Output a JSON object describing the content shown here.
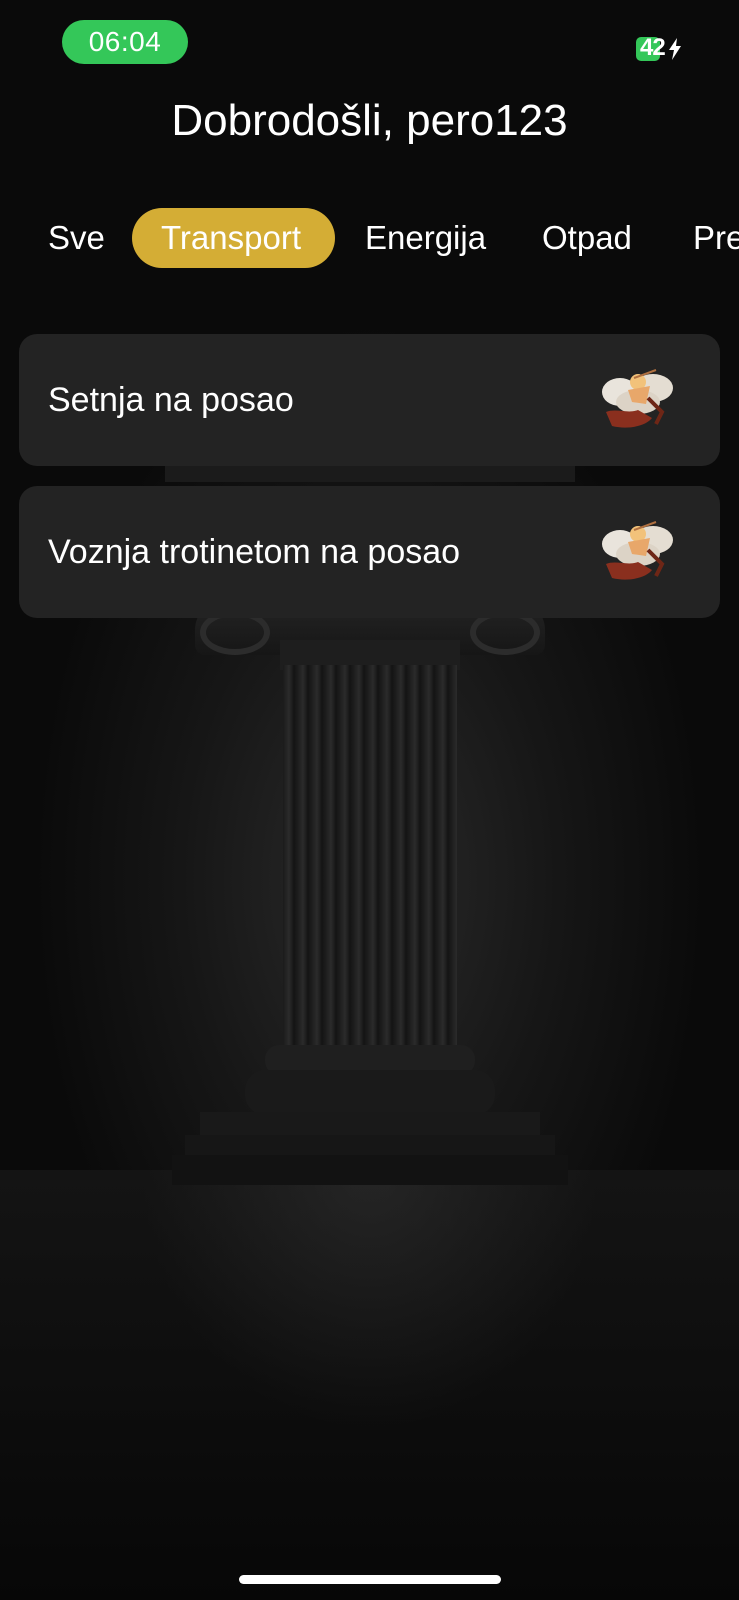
{
  "status_bar": {
    "time": "06:04",
    "battery_level": "42",
    "time_pill_color": "#34c759",
    "charging": true
  },
  "header": {
    "greeting": "Dobrodošli, pero123"
  },
  "tabs": [
    {
      "label": "Sve",
      "active": false
    },
    {
      "label": "Transport",
      "active": true
    },
    {
      "label": "Energija",
      "active": false
    },
    {
      "label": "Otpad",
      "active": false
    },
    {
      "label": "Pre",
      "active": false
    }
  ],
  "accent_color": "#d4ad35",
  "cards": [
    {
      "label": "Setnja na posao",
      "icon": "cupid-illustration-icon"
    },
    {
      "label": "Voznja trotinetom na posao",
      "icon": "cupid-illustration-icon"
    }
  ]
}
